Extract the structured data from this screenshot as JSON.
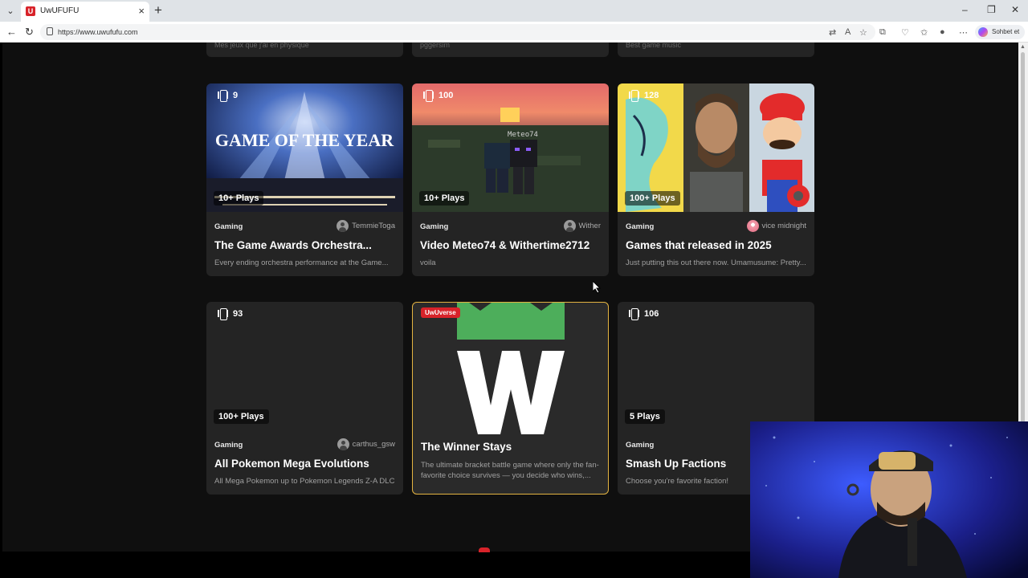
{
  "browser": {
    "tab_title": "UwUFUFU",
    "favicon_letter": "U",
    "url": "https://www.uwufufu.com",
    "profile_label": "Sohbet et"
  },
  "partial_cards": [
    {
      "desc": "Mes jeux que j'ai en physique"
    },
    {
      "desc": "pggersim"
    },
    {
      "desc": "Best game music"
    }
  ],
  "cards": [
    {
      "count": "9",
      "plays": "10+ Plays",
      "category": "Gaming",
      "author": "TemmieToga",
      "title": "The Game Awards Orchestra...",
      "desc": "Every ending orchestra performance at the Game...",
      "thumb_text": "GAME OF THE YEAR"
    },
    {
      "count": "100",
      "plays": "10+ Plays",
      "category": "Gaming",
      "author": "Wither",
      "title": "Video Meteo74 & Withertime2712",
      "desc": "voila",
      "thumb_text": "Meteo74"
    },
    {
      "count": "128",
      "plays": "100+ Plays",
      "category": "Gaming",
      "author": "vice midnight",
      "title": "Games that released in 2025",
      "desc": "Just putting this out there now. Umamusume: Pretty..."
    },
    {
      "count": "93",
      "plays": "100+ Plays",
      "category": "Gaming",
      "author": "carthus_gsw",
      "title": "All Pokemon Mega Evolutions",
      "desc": "All Mega Pokemon up to Pokemon Legends Z-A DLC"
    },
    {
      "badge": "UwUverse",
      "title": "The Winner Stays",
      "desc": "The ultimate bracket battle game where only the fan-favorite choice survives — you decide who wins,..."
    },
    {
      "count": "106",
      "plays": "5 Plays",
      "category": "Gaming",
      "title": "Smash Up Factions",
      "desc": "Choose you're favorite faction!"
    }
  ],
  "colors": {
    "accent": "#d8232a",
    "card_bg": "#242424",
    "page_bg": "#0f0f0f",
    "winner_border": "#e3b341",
    "winner_green": "#4dae5b"
  }
}
